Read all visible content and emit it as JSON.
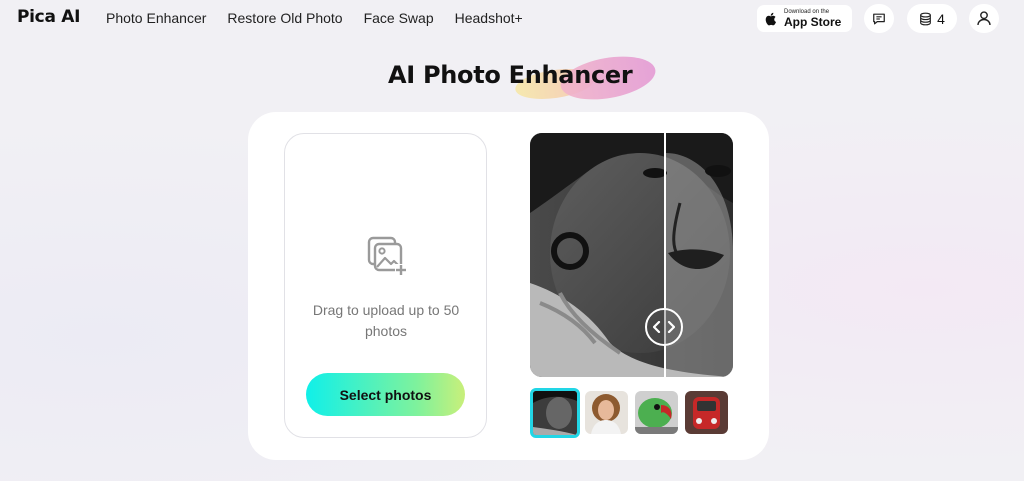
{
  "header": {
    "logo": "Pica AI",
    "nav": [
      "Photo Enhancer",
      "Restore Old Photo",
      "Face Swap",
      "Headshot+"
    ],
    "app_store": {
      "small": "Download on the",
      "big": "App Store"
    },
    "credits": "4"
  },
  "main": {
    "title": "AI Photo Enhancer",
    "upload": {
      "text": "Drag to upload up to 50 photos",
      "button": "Select photos"
    },
    "thumbnails": [
      "portrait-bw",
      "woman-curly-hair",
      "green-parrot",
      "red-car"
    ]
  },
  "colors": {
    "accent_gradient_start": "#10f0e9",
    "accent_gradient_end": "#c9ef7a",
    "active_thumb_border": "#22d6e6",
    "background": "#f1f0f4"
  },
  "icons": [
    "apple-icon",
    "message-icon",
    "coins-icon",
    "user-icon",
    "image-upload-icon",
    "compare-arrows-icon"
  ]
}
